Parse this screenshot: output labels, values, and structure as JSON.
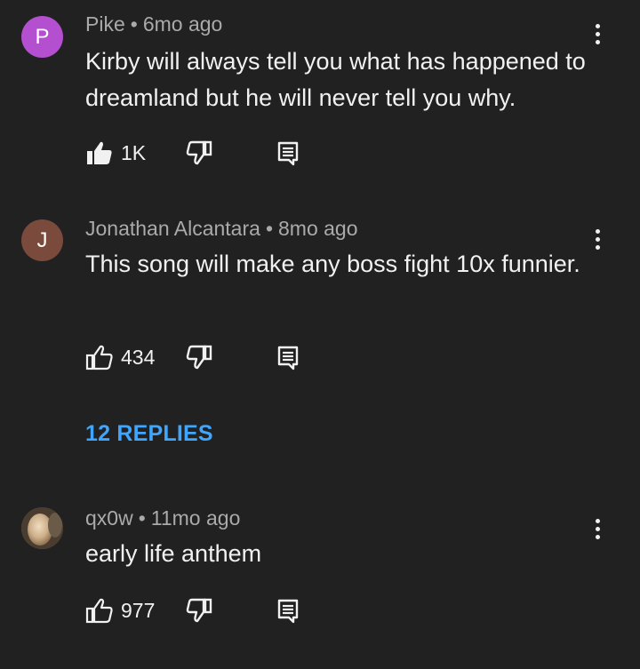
{
  "comments": [
    {
      "avatar_letter": "P",
      "avatar_color": "#b44fcf",
      "author": "Pike",
      "separator": "•",
      "time": "6mo ago",
      "text": "Kirby will always tell you what has happened to dreamland but he will never tell you why.",
      "likes": "1K",
      "liked": true
    },
    {
      "avatar_letter": "J",
      "avatar_color": "#7a4a3d",
      "author": "Jonathan Alcantara",
      "separator": "•",
      "time": "8mo ago",
      "text": "This song will make any boss fight 10x funnier.",
      "likes": "434",
      "liked": false
    },
    {
      "avatar_letter": "",
      "avatar_color": "#6b5a44",
      "author": "qx0w",
      "separator": "•",
      "time": "11mo ago",
      "text": "early life anthem",
      "likes": "977",
      "liked": false
    }
  ],
  "replies_label": "12 REPLIES",
  "colors": {
    "background": "#212121",
    "text": "#f1f1f1",
    "meta": "#aaaaaa",
    "link": "#3ea6ff"
  }
}
